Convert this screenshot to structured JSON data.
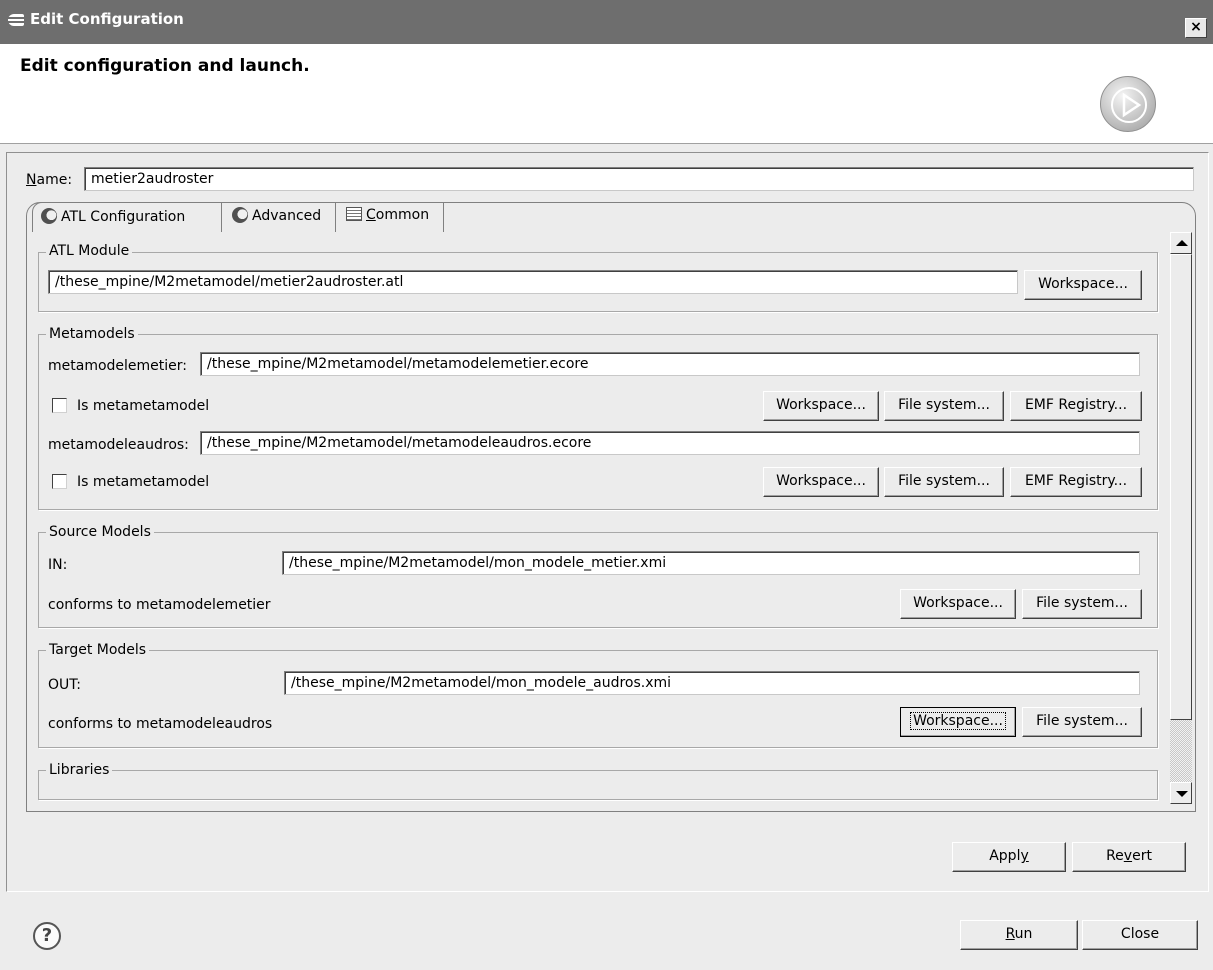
{
  "window": {
    "title": "Edit Configuration",
    "close_glyph": "×"
  },
  "header": {
    "heading": "Edit configuration and launch.",
    "icon": "run-icon"
  },
  "name": {
    "label_prefix": "N",
    "label_rest": "ame:",
    "value": "metier2audroster"
  },
  "tabs": [
    {
      "label": "ATL Configuration",
      "icon": "atl-icon",
      "active": true
    },
    {
      "label": "Advanced",
      "icon": "atl-icon",
      "active": false
    },
    {
      "label_prefix": "C",
      "label_rest": "ommon",
      "icon": "list-icon",
      "active": false
    }
  ],
  "atl_module": {
    "title": "ATL Module",
    "path": "/these_mpine/M2metamodel/metier2audroster.atl",
    "workspace_btn": "Workspace..."
  },
  "metamodels": {
    "title": "Metamodels",
    "items": [
      {
        "label": "metamodelemetier:",
        "path": "/these_mpine/M2metamodel/metamodelemetier.ecore",
        "checkbox_label": "Is metametamodel",
        "checked": false
      },
      {
        "label": "metamodeleaudros:",
        "path": "/these_mpine/M2metamodel/metamodeleaudros.ecore",
        "checkbox_label": "Is metametamodel",
        "checked": false
      }
    ],
    "workspace_btn": "Workspace...",
    "filesystem_btn": "File system...",
    "emf_btn": "EMF Registry..."
  },
  "source_models": {
    "title": "Source Models",
    "label": "IN:",
    "path": "/these_mpine/M2metamodel/mon_modele_metier.xmi",
    "conforms": "conforms to metamodelemetier",
    "workspace_btn": "Workspace...",
    "filesystem_btn": "File system..."
  },
  "target_models": {
    "title": "Target Models",
    "label": "OUT:",
    "path": "/these_mpine/M2metamodel/mon_modele_audros.xmi",
    "conforms": "conforms to metamodeleaudros",
    "workspace_btn": "Workspace...",
    "filesystem_btn": "File system..."
  },
  "libraries": {
    "title": "Libraries"
  },
  "actions": {
    "apply_prefix": "Appl",
    "apply_mnemonic": "y",
    "revert_prefix": "Re",
    "revert_mnemonic": "v",
    "revert_rest": "ert",
    "run_mnemonic": "R",
    "run_rest": "un",
    "close": "Close"
  },
  "help": {
    "glyph": "?",
    "icon": "help-icon"
  }
}
